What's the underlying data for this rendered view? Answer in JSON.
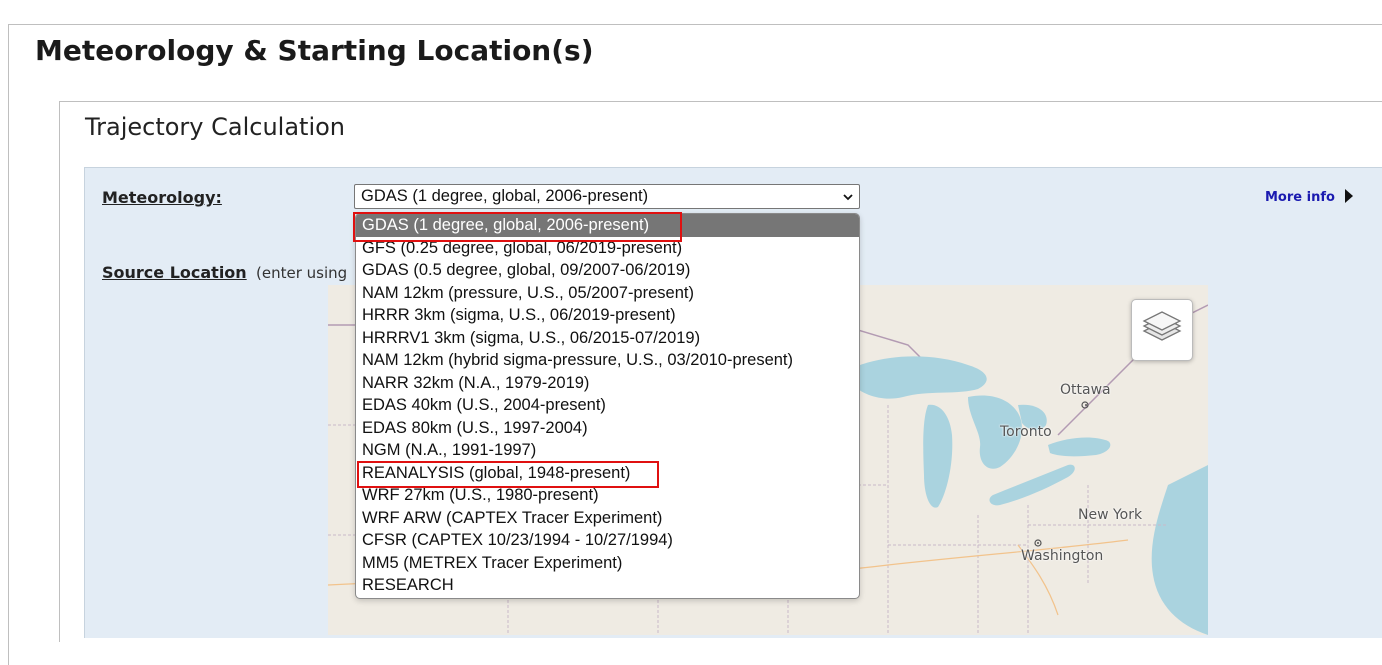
{
  "page": {
    "title": "Meteorology & Starting Location(s)"
  },
  "panel": {
    "title": "Trajectory Calculation"
  },
  "form": {
    "meteorology_label": "Meteorology:",
    "source_location_label": "Source Location",
    "source_location_hint": "(enter using",
    "more_info_label": "More info",
    "meteorology_select": {
      "selected": "GDAS (1 degree, global, 2006-present)",
      "options": [
        "GDAS (1 degree, global, 2006-present)",
        "GFS (0.25 degree, global, 06/2019-present)",
        "GDAS (0.5 degree, global, 09/2007-06/2019)",
        "NAM 12km (pressure, U.S., 05/2007-present)",
        "HRRR 3km (sigma, U.S., 06/2019-present)",
        "HRRRV1 3km (sigma, U.S., 06/2015-07/2019)",
        "NAM 12km (hybrid sigma-pressure, U.S., 03/2010-present)",
        "NARR 32km (N.A., 1979-2019)",
        "EDAS 40km (U.S., 2004-present)",
        "EDAS 80km (U.S., 1997-2004)",
        "NGM (N.A., 1991-1997)",
        "REANALYSIS (global, 1948-present)",
        "WRF 27km (U.S., 1980-present)",
        "WRF ARW (CAPTEX Tracer Experiment)",
        "CFSR (CAPTEX 10/23/1994 - 10/27/1994)",
        "MM5 (METREX Tracer Experiment)",
        "RESEARCH"
      ]
    }
  },
  "map": {
    "labels": {
      "ottawa": "Ottawa",
      "toronto": "Toronto",
      "new_york": "New York",
      "washington": "Washington"
    },
    "icons": {
      "layers": "layers-icon"
    }
  },
  "colors": {
    "form_background": "#e3ecf5",
    "highlight": "#e01010",
    "selected_option": "#767676",
    "link": "#1b1bb0",
    "water": "#aad3df",
    "land": "#efebe3"
  }
}
